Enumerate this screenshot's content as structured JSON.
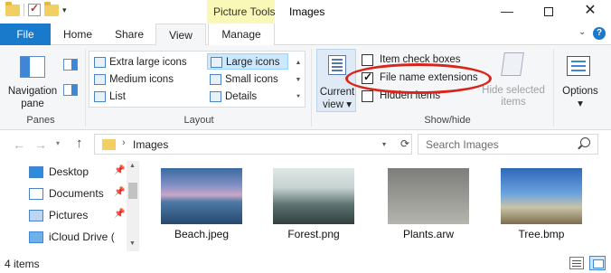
{
  "window": {
    "title": "Images",
    "contextual_tab_group": "Picture Tools",
    "controls": [
      "minimize",
      "maximize",
      "close"
    ]
  },
  "tabs": [
    {
      "label": "File"
    },
    {
      "label": "Home"
    },
    {
      "label": "Share"
    },
    {
      "label": "View",
      "active": true
    },
    {
      "label": "Manage"
    }
  ],
  "ribbon": {
    "panes": {
      "navigation_pane": "Navigation pane",
      "group_label": "Panes"
    },
    "layout": {
      "options": {
        "extra_large": "Extra large icons",
        "large": "Large icons",
        "medium": "Medium icons",
        "small": "Small icons",
        "list": "List",
        "details": "Details"
      },
      "selected": "Large icons",
      "group_label": "Layout"
    },
    "current_view": {
      "label": "Current view"
    },
    "show_hide": {
      "item_check_boxes": {
        "label": "Item check boxes",
        "checked": false
      },
      "file_name_extensions": {
        "label": "File name extensions",
        "checked": true
      },
      "hidden_items": {
        "label": "Hidden items",
        "checked": false
      },
      "hide_selected": "Hide selected items",
      "group_label": "Show/hide"
    },
    "options": {
      "label": "Options"
    }
  },
  "address": {
    "path": "Images",
    "search_placeholder": "Search Images"
  },
  "nav_pane": {
    "items": [
      {
        "label": "Desktop",
        "icon": "desktop-icon",
        "pinned": true
      },
      {
        "label": "Documents",
        "icon": "documents-icon",
        "pinned": true
      },
      {
        "label": "Pictures",
        "icon": "pictures-icon",
        "pinned": true
      },
      {
        "label": "iCloud Drive (",
        "icon": "icloud-icon",
        "pinned": true
      }
    ]
  },
  "files": [
    {
      "name": "Beach.jpeg",
      "icon": "beach-thumbnail"
    },
    {
      "name": "Forest.png",
      "icon": "forest-thumbnail"
    },
    {
      "name": "Plants.arw",
      "icon": "plants-thumbnail"
    },
    {
      "name": "Tree.bmp",
      "icon": "tree-thumbnail"
    }
  ],
  "status": {
    "item_count": "4 items"
  },
  "colors": {
    "file_tab": "#1979ca",
    "picture_tools": "#f9f8b6",
    "highlight": "#d8251c",
    "selection": "#cce8ff"
  }
}
